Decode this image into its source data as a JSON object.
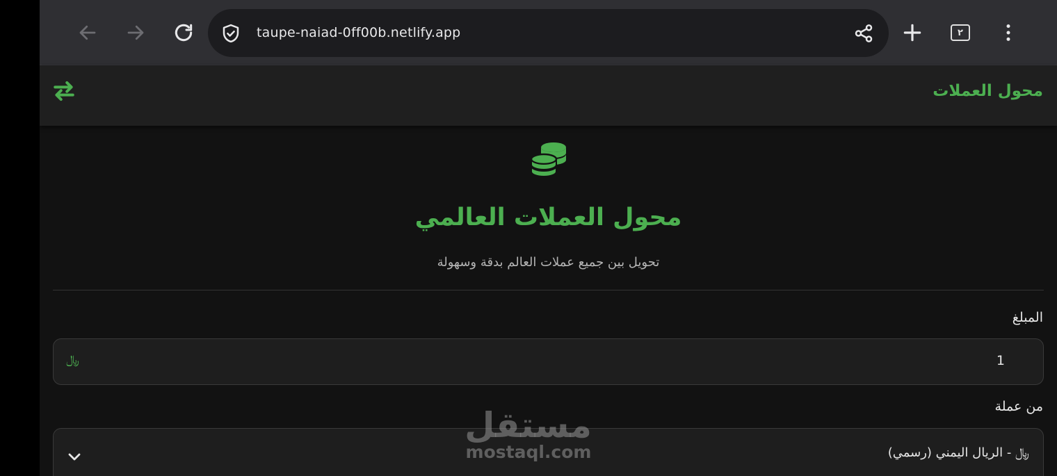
{
  "browser": {
    "url": "taupe-naiad-0ff00b.netlify.app",
    "tab_count": "٢"
  },
  "header": {
    "brand": "محول العملات"
  },
  "hero": {
    "title": "محول العملات العالمي",
    "subtitle": "تحويل بين جميع عملات العالم بدقة وسهولة"
  },
  "form": {
    "amount_label": "المبلغ",
    "amount_value": "1",
    "amount_currency_symbol": "﷼",
    "from_label": "من عملة",
    "from_value": "﷼ - الريال اليمني (رسمي)"
  },
  "watermark": {
    "arabic": "مستقل",
    "latin": "mostaql.com"
  },
  "colors": {
    "accent": "#4caf50",
    "background": "#121212",
    "header": "#1f1f1f",
    "browser_bar": "#2f2f33"
  },
  "icons": {
    "back": "arrow-left-icon",
    "forward": "arrow-right-icon",
    "reload": "reload-icon",
    "security": "shield-check-icon",
    "share": "share-icon",
    "new_tab": "plus-icon",
    "menu": "kebab-menu-icon",
    "swap": "swap-arrows-icon",
    "coins": "coins-icon",
    "dropdown": "chevron-down-icon"
  }
}
